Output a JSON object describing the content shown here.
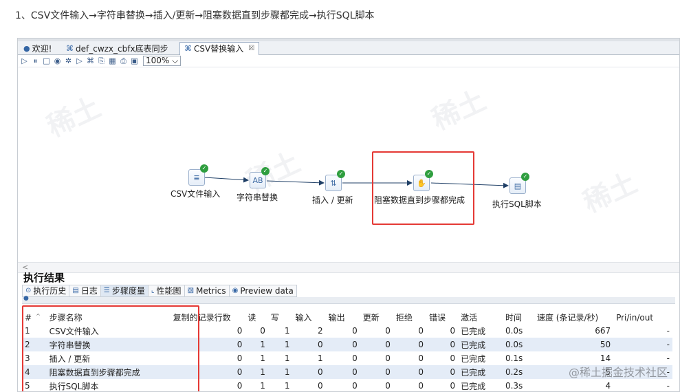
{
  "heading": "1、CSV文件输入→字符串替换→插入/更新→阻塞数据直到步骤都完成→执行SQL脚本",
  "tabs": [
    {
      "icon": "kettle-icon",
      "label": "欢迎!"
    },
    {
      "icon": "job-icon",
      "label": "def_cwzx_cbfx底表同步"
    },
    {
      "icon": "transform-icon",
      "label": "CSV替换输入",
      "close": "☒"
    }
  ],
  "toolbar": {
    "zoom": "100%",
    "zoom_caret": "⌵"
  },
  "scroll_left": "<",
  "nodes": [
    {
      "label": "CSV文件输入",
      "glyph": "≣"
    },
    {
      "label": "字符串替换",
      "glyph": "AB"
    },
    {
      "label": "插入 / 更新",
      "glyph": "⇅"
    },
    {
      "label": "阻塞数据直到步骤都完成",
      "glyph": "✋"
    },
    {
      "label": "执行SQL脚本",
      "glyph": "▤"
    }
  ],
  "results": {
    "title": "执行结果",
    "tabs": [
      {
        "icon": "history-icon",
        "label": "执行历史"
      },
      {
        "icon": "log-icon",
        "label": "日志"
      },
      {
        "icon": "metrics-icon",
        "label": "步骤度量"
      },
      {
        "icon": "perf-chart-icon",
        "label": "性能图"
      },
      {
        "icon": "metrics-doc-icon",
        "label": "Metrics"
      },
      {
        "icon": "eye-icon",
        "label": "Preview data"
      }
    ],
    "columns": [
      "#",
      "步骤名称",
      "复制的记录行数",
      "读",
      "写",
      "输入",
      "输出",
      "更新",
      "拒绝",
      "错误",
      "激活",
      "时间",
      "速度 (条记录/秒)",
      "Pri/in/out"
    ],
    "rows": [
      [
        "1",
        "CSV文件输入",
        "0",
        "0",
        "1",
        "2",
        "0",
        "0",
        "0",
        "0",
        "已完成",
        "0.0s",
        "667",
        "-"
      ],
      [
        "2",
        "字符串替换",
        "0",
        "1",
        "1",
        "0",
        "0",
        "0",
        "0",
        "0",
        "已完成",
        "0.0s",
        "50",
        "-"
      ],
      [
        "3",
        "插入 / 更新",
        "0",
        "1",
        "1",
        "1",
        "0",
        "0",
        "0",
        "0",
        "已完成",
        "0.1s",
        "14",
        "-"
      ],
      [
        "4",
        "阻塞数据直到步骤都完成",
        "0",
        "1",
        "1",
        "0",
        "0",
        "0",
        "0",
        "0",
        "已完成",
        "0.2s",
        "5",
        "-"
      ],
      [
        "5",
        "执行SQL脚本",
        "0",
        "1",
        "1",
        "0",
        "0",
        "0",
        "0",
        "0",
        "已完成",
        "0.3s",
        "4",
        "-"
      ]
    ]
  },
  "watermark": "@稀土掘金技术社区",
  "colors": {
    "highlight": "#e53935",
    "success": "#2f9e3f",
    "row_alt": "#e4ecf7"
  }
}
